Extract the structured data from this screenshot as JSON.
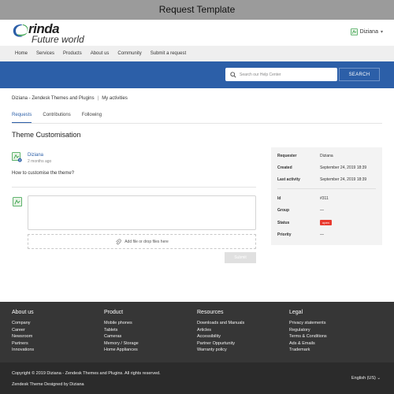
{
  "window": {
    "title": "Request Template"
  },
  "brand": {
    "name": "rinda",
    "tagline": "Future world",
    "accent": "#2c5fa8",
    "logo_green": "#2f9e44"
  },
  "user": {
    "name": "Diziana",
    "caret": "▾"
  },
  "nav": {
    "items": [
      "Home",
      "Services",
      "Products",
      "About us",
      "Community",
      "Submit a request"
    ]
  },
  "search": {
    "placeholder": "Search our Help Center",
    "button": "SEARCH"
  },
  "breadcrumb": {
    "items": [
      "Diziana - Zendesk Themes and Plugins",
      "My activities"
    ],
    "separator": "|"
  },
  "tabs": [
    {
      "label": "Requests",
      "active": true
    },
    {
      "label": "Contributions",
      "active": false
    },
    {
      "label": "Following",
      "active": false
    }
  ],
  "request": {
    "title": "Theme Customisation",
    "comment": {
      "author": "Diziana",
      "time": "2 months ago",
      "body": "How to customise the theme?"
    }
  },
  "reply": {
    "attach_label": "Add file or drop files here",
    "submit_label": "Submit"
  },
  "details": {
    "requester_label": "Requester",
    "requester_value": "Diziana",
    "created_label": "Created",
    "created_value": "September 24, 2019 18:39",
    "activity_label": "Last activity",
    "activity_value": "September 24, 2019 18:39",
    "id_label": "Id",
    "id_value": "#311",
    "group_label": "Group",
    "group_value": "—",
    "status_label": "Status",
    "status_value": "open",
    "status_color": "#e8392e",
    "priority_label": "Priority",
    "priority_value": "—"
  },
  "footer": {
    "about": {
      "title": "About us",
      "links": [
        "Company",
        "Career",
        "Newsroom",
        "Partners",
        "Innovations"
      ]
    },
    "product": {
      "title": "Product",
      "links": [
        "Mobile phones",
        "Tablets",
        "Cameras",
        "Memory / Storage",
        "Home Appliances"
      ]
    },
    "resources": {
      "title": "Resources",
      "links": [
        "Downloads and Manuals",
        "Articles",
        "Accessibility",
        "Partner Oppurtunity",
        "Warranty policy"
      ]
    },
    "legal": {
      "title": "Legal",
      "links": [
        "Privacy statements",
        "Regulatory",
        "Terms & Conditions",
        "Ads & Emails",
        "Trademark"
      ]
    },
    "copyright": "Copyright © 2019 Diziana - Zendesk Themes and Plugins. All rights reserved.",
    "designed_by": "Zendesk Theme Designed by Diziana",
    "language": "English (US) ⌄"
  }
}
